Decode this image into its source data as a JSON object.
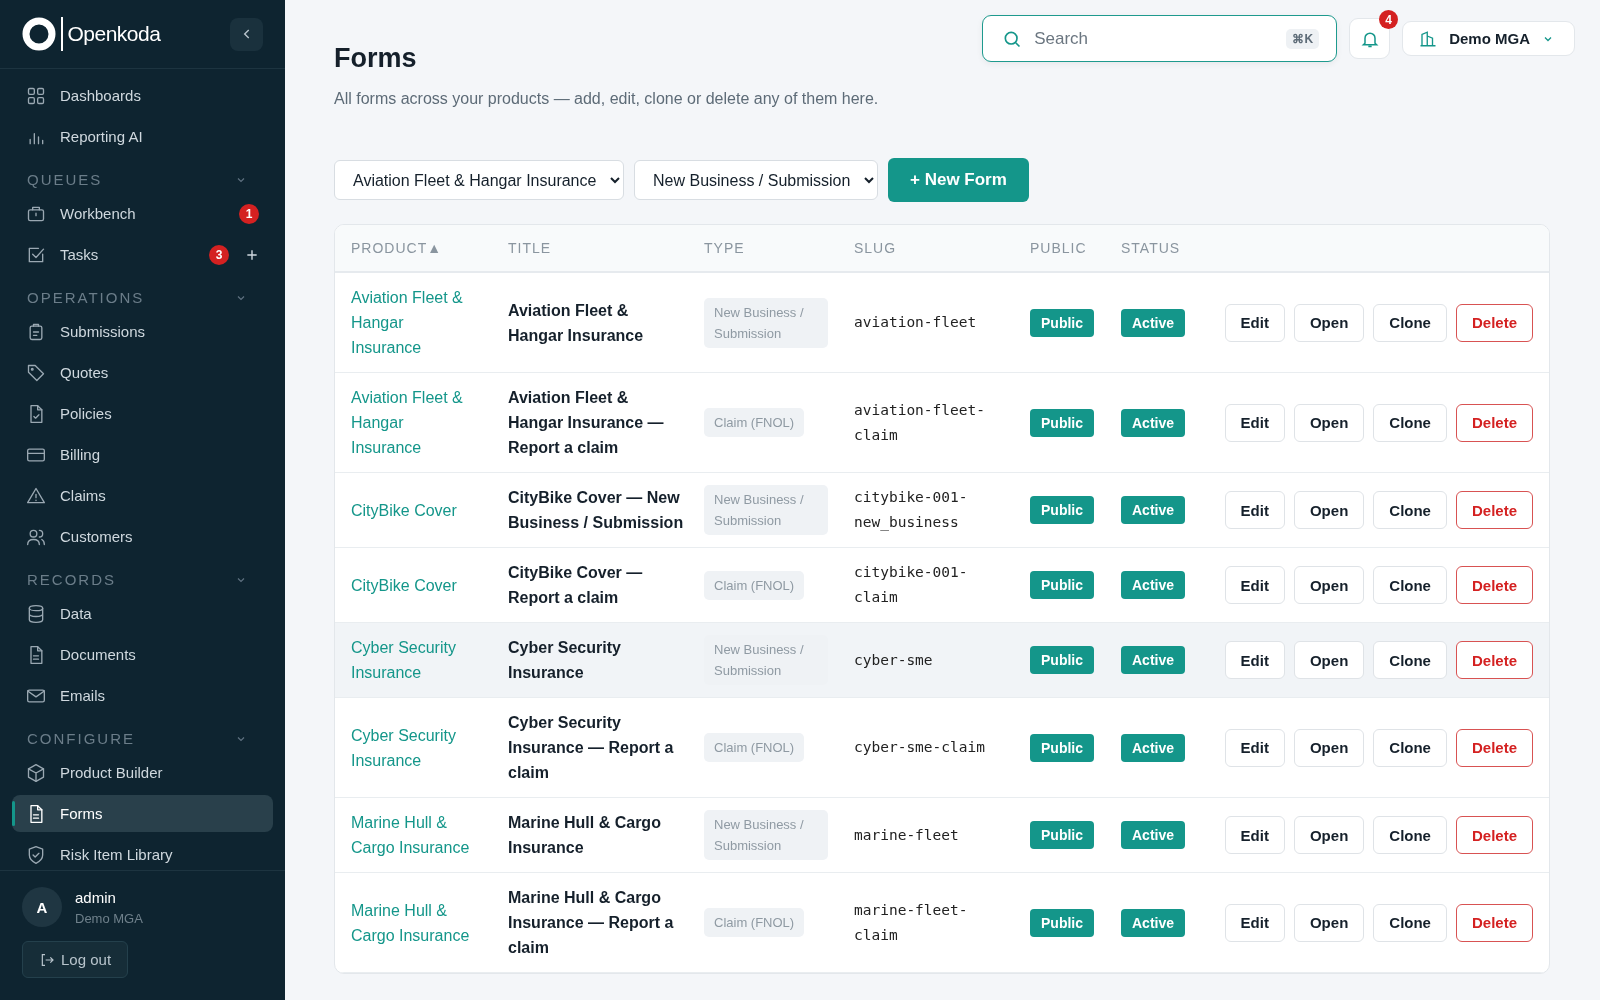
{
  "sidebar": {
    "brand": "Openkoda",
    "top_items": [
      {
        "label": "Dashboards",
        "selected": false
      },
      {
        "label": "Reporting AI",
        "selected": false
      }
    ],
    "sections": [
      {
        "label": "QUEUES",
        "expanded": true,
        "items": [
          {
            "label": "Workbench",
            "selected": false,
            "badge": "1"
          },
          {
            "label": "Tasks",
            "selected": false,
            "badge": "3",
            "add": true
          }
        ]
      },
      {
        "label": "OPERATIONS",
        "expanded": true,
        "items": [
          {
            "label": "Submissions",
            "selected": false
          },
          {
            "label": "Quotes",
            "selected": false
          },
          {
            "label": "Policies",
            "selected": false
          },
          {
            "label": "Billing",
            "selected": false
          },
          {
            "label": "Claims",
            "selected": false
          },
          {
            "label": "Customers",
            "selected": false
          }
        ]
      },
      {
        "label": "RECORDS",
        "expanded": true,
        "items": [
          {
            "label": "Data",
            "selected": false
          },
          {
            "label": "Documents",
            "selected": false
          },
          {
            "label": "Emails",
            "selected": false
          }
        ]
      },
      {
        "label": "CONFIGURE",
        "expanded": true,
        "items": [
          {
            "label": "Product Builder",
            "selected": false
          },
          {
            "label": "Forms",
            "selected": true
          },
          {
            "label": "Risk Item Library",
            "selected": false
          }
        ]
      }
    ],
    "user": {
      "initial": "A",
      "name": "admin",
      "org": "Demo MGA"
    },
    "logout": "Log out"
  },
  "header": {
    "search": {
      "placeholder": "Search",
      "shortcut": "⌘K"
    },
    "notifications": "4",
    "org": "Demo MGA"
  },
  "page": {
    "title": "Forms",
    "subtitle": "All forms across your products — add, edit, clone or delete any of them here."
  },
  "filters": [
    {
      "value": "Aviation Fleet & Hangar Insurance"
    },
    {
      "value": "New Business / Submission"
    }
  ],
  "new_button": "+ New Form",
  "table": {
    "columns": [
      {
        "label": "PRODUCT",
        "sort": "▲"
      },
      {
        "label": "TITLE"
      },
      {
        "label": "TYPE"
      },
      {
        "label": "SLUG"
      },
      {
        "label": "PUBLIC"
      },
      {
        "label": "STATUS"
      }
    ],
    "rows": [
      {
        "product": "Aviation Fleet & Hangar Insurance",
        "title": "Aviation Fleet & Hangar Insurance",
        "type": "New Business / Submission",
        "slug": "aviation-fleet",
        "public": "Public",
        "status": "Active",
        "hovered": false,
        "actions": [
          {
            "label": "Edit",
            "kind": "default"
          },
          {
            "label": "Open",
            "kind": "default"
          },
          {
            "label": "Clone",
            "kind": "default"
          },
          {
            "label": "Delete",
            "kind": "danger"
          }
        ]
      },
      {
        "product": "Aviation Fleet & Hangar Insurance",
        "title": "Aviation Fleet & Hangar Insurance — Report a claim",
        "type": "Claim (FNOL)",
        "slug": "aviation-fleet-claim",
        "public": "Public",
        "status": "Active",
        "hovered": false,
        "actions": [
          {
            "label": "Edit",
            "kind": "default"
          },
          {
            "label": "Open",
            "kind": "default"
          },
          {
            "label": "Clone",
            "kind": "default"
          },
          {
            "label": "Delete",
            "kind": "danger"
          }
        ]
      },
      {
        "product": "CityBike Cover",
        "title": "CityBike Cover — New Business / Submission",
        "type": "New Business / Submission",
        "slug": "citybike-001-new_business",
        "public": "Public",
        "status": "Active",
        "hovered": false,
        "actions": [
          {
            "label": "Edit",
            "kind": "default"
          },
          {
            "label": "Open",
            "kind": "default"
          },
          {
            "label": "Clone",
            "kind": "default"
          },
          {
            "label": "Delete",
            "kind": "danger"
          }
        ]
      },
      {
        "product": "CityBike Cover",
        "title": "CityBike Cover — Report a claim",
        "type": "Claim (FNOL)",
        "slug": "citybike-001-claim",
        "public": "Public",
        "status": "Active",
        "hovered": false,
        "actions": [
          {
            "label": "Edit",
            "kind": "default"
          },
          {
            "label": "Open",
            "kind": "default"
          },
          {
            "label": "Clone",
            "kind": "default"
          },
          {
            "label": "Delete",
            "kind": "danger"
          }
        ]
      },
      {
        "product": "Cyber Security Insurance",
        "title": "Cyber Security Insurance",
        "type": "New Business / Submission",
        "slug": "cyber-sme",
        "public": "Public",
        "status": "Active",
        "hovered": true,
        "actions": [
          {
            "label": "Edit",
            "kind": "default"
          },
          {
            "label": "Open",
            "kind": "default"
          },
          {
            "label": "Clone",
            "kind": "default"
          },
          {
            "label": "Delete",
            "kind": "danger"
          }
        ]
      },
      {
        "product": "Cyber Security Insurance",
        "title": "Cyber Security Insurance — Report a claim",
        "type": "Claim (FNOL)",
        "slug": "cyber-sme-claim",
        "public": "Public",
        "status": "Active",
        "hovered": false,
        "actions": [
          {
            "label": "Edit",
            "kind": "default"
          },
          {
            "label": "Open",
            "kind": "default"
          },
          {
            "label": "Clone",
            "kind": "default"
          },
          {
            "label": "Delete",
            "kind": "danger"
          }
        ]
      },
      {
        "product": "Marine Hull & Cargo Insurance",
        "title": "Marine Hull & Cargo Insurance",
        "type": "New Business / Submission",
        "slug": "marine-fleet",
        "public": "Public",
        "status": "Active",
        "hovered": false,
        "actions": [
          {
            "label": "Edit",
            "kind": "default"
          },
          {
            "label": "Open",
            "kind": "default"
          },
          {
            "label": "Clone",
            "kind": "default"
          },
          {
            "label": "Delete",
            "kind": "danger"
          }
        ]
      },
      {
        "product": "Marine Hull & Cargo Insurance",
        "title": "Marine Hull & Cargo Insurance — Report a claim",
        "type": "Claim (FNOL)",
        "slug": "marine-fleet-claim",
        "public": "Public",
        "status": "Active",
        "hovered": false,
        "actions": [
          {
            "label": "Edit",
            "kind": "default"
          },
          {
            "label": "Open",
            "kind": "default"
          },
          {
            "label": "Clone",
            "kind": "default"
          },
          {
            "label": "Delete",
            "kind": "danger"
          }
        ]
      }
    ]
  }
}
